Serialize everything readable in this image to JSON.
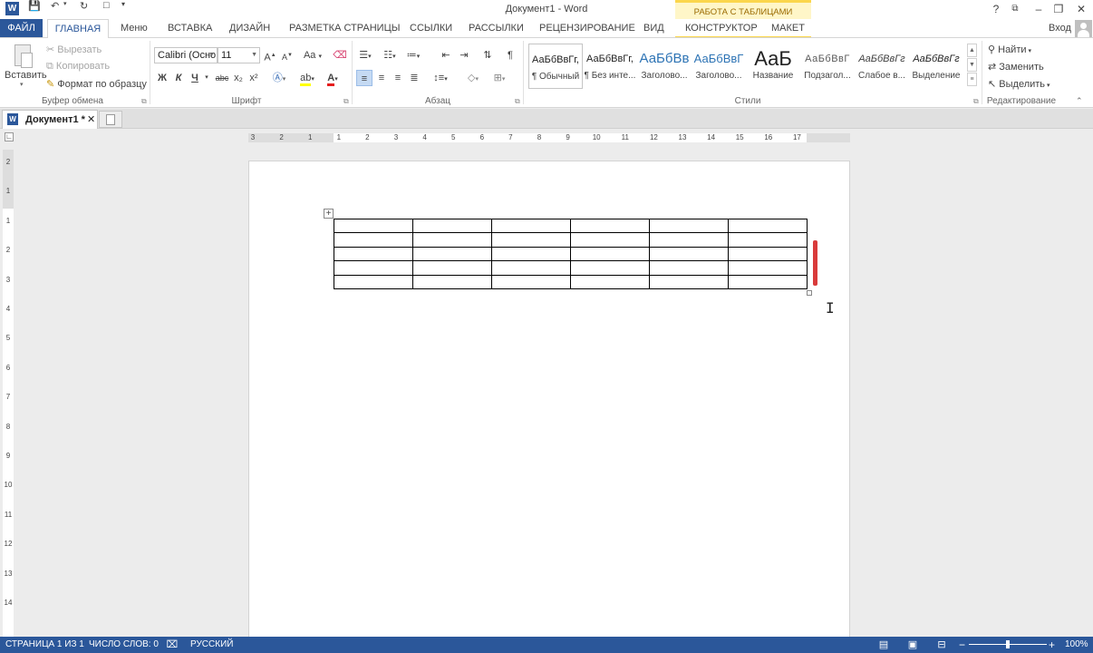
{
  "app": {
    "title": "Документ1 - Word",
    "context_tab_header": "РАБОТА С ТАБЛИЦАМИ",
    "user_login": "Вход"
  },
  "tabs": {
    "file": "ФАЙЛ",
    "home": "ГЛАВНАЯ",
    "menu": "Меню",
    "insert": "ВСТАВКА",
    "design": "ДИЗАЙН",
    "layout": "РАЗМЕТКА СТРАНИЦЫ",
    "references": "ССЫЛКИ",
    "mailings": "РАССЫЛКИ",
    "review": "РЕЦЕНЗИРОВАНИЕ",
    "view": "ВИД",
    "constructor": "КОНСТРУКТОР",
    "table_layout": "МАКЕТ"
  },
  "clipboard": {
    "label": "Буфер обмена",
    "paste": "Вставить",
    "cut": "Вырезать",
    "copy": "Копировать",
    "format_painter": "Формат по образцу"
  },
  "font": {
    "label": "Шрифт",
    "font_name": "Calibri (Осно",
    "font_size": "11",
    "bold": "Ж",
    "italic": "К",
    "underline": "Ч",
    "strike": "abc",
    "subscript": "x₂",
    "superscript": "x²",
    "grow": "A",
    "shrink": "A",
    "case": "Aa",
    "font_color": "A"
  },
  "paragraph": {
    "label": "Абзац"
  },
  "styles": {
    "label": "Стили",
    "items": [
      {
        "sample": "АаБбВвГг,",
        "name": "¶ Обычный"
      },
      {
        "sample": "АаБбВвГг,",
        "name": "¶ Без инте..."
      },
      {
        "sample": "АаБбВв",
        "name": "Заголово..."
      },
      {
        "sample": "АаБбВвГ",
        "name": "Заголово..."
      },
      {
        "sample": "АаБ",
        "name": "Название"
      },
      {
        "sample": "АаБбВвГ",
        "name": "Подзагол..."
      },
      {
        "sample": "АаБбВвГг",
        "name": "Слабое в..."
      },
      {
        "sample": "АаБбВвГг",
        "name": "Выделение"
      }
    ]
  },
  "editing": {
    "label": "Редактирование",
    "find": "Найти",
    "replace": "Заменить",
    "select": "Выделить"
  },
  "doc_tab": {
    "name": "Документ1 *"
  },
  "ruler": {
    "h_ticks": [
      "3",
      "2",
      "1",
      "1",
      "2",
      "3",
      "4",
      "5",
      "6",
      "7",
      "8",
      "9",
      "10",
      "11",
      "12",
      "13",
      "14",
      "15",
      "16",
      "17"
    ],
    "v_ticks": [
      "2",
      "1",
      "1",
      "2",
      "3",
      "4",
      "5",
      "6",
      "7",
      "8",
      "9",
      "10",
      "11",
      "12",
      "13",
      "14"
    ]
  },
  "table": {
    "rows": 5,
    "cols": 6
  },
  "status": {
    "page": "СТРАНИЦА 1 ИЗ 1",
    "words": "ЧИСЛО СЛОВ: 0",
    "language": "РУССКИЙ",
    "zoom_minus": "−",
    "zoom_plus": "+",
    "zoom": "100%",
    "zoom_fraction": 0.5
  },
  "colors": {
    "accent": "#2b579a",
    "context_tab": "#fbd64c",
    "marker": "#d93b3b"
  }
}
